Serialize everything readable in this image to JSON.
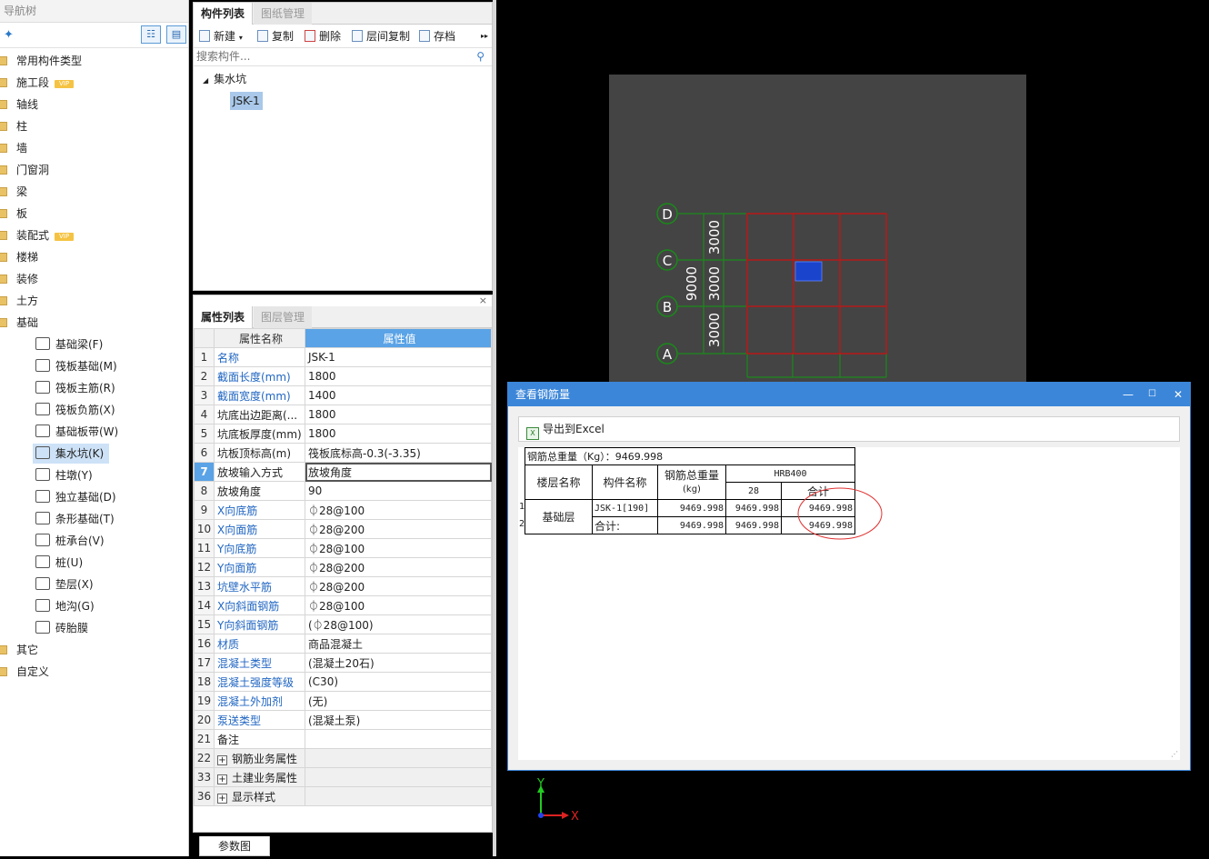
{
  "nav": {
    "title": "导航树",
    "view_toggle_1": "☷",
    "view_toggle_2": "▤",
    "items": [
      {
        "label": "常用构件类型",
        "vip": ""
      },
      {
        "label": "施工段",
        "vip": "VIP"
      },
      {
        "label": "轴线",
        "vip": ""
      },
      {
        "label": "柱",
        "vip": ""
      },
      {
        "label": "墙",
        "vip": ""
      },
      {
        "label": "门窗洞",
        "vip": ""
      },
      {
        "label": "梁",
        "vip": ""
      },
      {
        "label": "板",
        "vip": ""
      },
      {
        "label": "装配式",
        "vip": "VIP"
      },
      {
        "label": "楼梯",
        "vip": ""
      },
      {
        "label": "装修",
        "vip": ""
      },
      {
        "label": "土方",
        "vip": ""
      },
      {
        "label": "基础",
        "vip": ""
      }
    ],
    "children": [
      "基础梁(F)",
      "筏板基础(M)",
      "筏板主筋(R)",
      "筏板负筋(X)",
      "基础板带(W)",
      "集水坑(K)",
      "柱墩(Y)",
      "独立基础(D)",
      "条形基础(T)",
      "桩承台(V)",
      "桩(U)",
      "垫层(X)",
      "地沟(G)",
      "砖胎膜"
    ],
    "selected_child": "集水坑(K)",
    "tail_items": [
      "其它",
      "自定义"
    ]
  },
  "complist": {
    "tab_active": "构件列表",
    "tab_inactive": "图纸管理",
    "toolbar": {
      "new": "新建",
      "copy": "复制",
      "delete": "删除",
      "floor_copy": "层间复制",
      "archive": "存档",
      "more": "▸▸"
    },
    "search_placeholder": "搜索构件...",
    "tree_root": "集水坑",
    "tree_item": "JSK-1"
  },
  "props": {
    "tab_active": "属性列表",
    "tab_inactive": "图层管理",
    "header_name": "属性名称",
    "header_value": "属性值",
    "rows": [
      {
        "num": "1",
        "name": "名称",
        "value": "JSK-1",
        "blue": true
      },
      {
        "num": "2",
        "name": "截面长度(mm)",
        "value": "1800",
        "blue": true
      },
      {
        "num": "3",
        "name": "截面宽度(mm)",
        "value": "1400",
        "blue": true
      },
      {
        "num": "4",
        "name": "坑底出边距离(...",
        "value": "1800",
        "blue": false
      },
      {
        "num": "5",
        "name": "坑底板厚度(mm)",
        "value": "1800",
        "blue": false
      },
      {
        "num": "6",
        "name": "坑板顶标高(m)",
        "value": "筏板底标高-0.3(-3.35)",
        "blue": false
      },
      {
        "num": "7",
        "name": "放坡输入方式",
        "value": "放坡角度",
        "blue": false
      },
      {
        "num": "8",
        "name": "放坡角度",
        "value": "90",
        "blue": false
      },
      {
        "num": "9",
        "name": "X向底筋",
        "value": "⏀28@100",
        "blue": true
      },
      {
        "num": "10",
        "name": "X向面筋",
        "value": "⏀28@200",
        "blue": true
      },
      {
        "num": "11",
        "name": "Y向底筋",
        "value": "⏀28@100",
        "blue": true
      },
      {
        "num": "12",
        "name": "Y向面筋",
        "value": "⏀28@200",
        "blue": true
      },
      {
        "num": "13",
        "name": "坑壁水平筋",
        "value": "⏀28@200",
        "blue": true
      },
      {
        "num": "14",
        "name": "X向斜面钢筋",
        "value": "⏀28@100",
        "blue": true
      },
      {
        "num": "15",
        "name": "Y向斜面钢筋",
        "value": "(⏀28@100)",
        "blue": true
      },
      {
        "num": "16",
        "name": "材质",
        "value": "商品混凝土",
        "blue": true
      },
      {
        "num": "17",
        "name": "混凝土类型",
        "value": "(混凝土20石)",
        "blue": true
      },
      {
        "num": "18",
        "name": "混凝土强度等级",
        "value": "(C30)",
        "blue": true
      },
      {
        "num": "19",
        "name": "混凝土外加剂",
        "value": "(无)",
        "blue": true
      },
      {
        "num": "20",
        "name": "泵送类型",
        "value": "(混凝土泵)",
        "blue": true
      },
      {
        "num": "21",
        "name": "备注",
        "value": "",
        "blue": false
      }
    ],
    "groups": [
      {
        "num": "22",
        "name": "钢筋业务属性"
      },
      {
        "num": "33",
        "name": "土建业务属性"
      },
      {
        "num": "36",
        "name": "显示样式"
      }
    ],
    "selected_row": "7",
    "bottom_tab": "参数图",
    "close": "×"
  },
  "canvas": {
    "axes_rows": [
      "D",
      "C",
      "B",
      "A"
    ],
    "dims_inner": [
      "3000",
      "3000",
      "3000"
    ],
    "dim_total": "9000",
    "axis_x": "X",
    "axis_y": "Y",
    "colors": {
      "bg": "#444444",
      "grid": "#cc1111",
      "green": "#1a8a1a",
      "pit": "#1a44cc"
    }
  },
  "dialog": {
    "title": "查看钢筋量",
    "btn_min": "—",
    "btn_max": "☐",
    "btn_close": "✕",
    "export": "导出到Excel",
    "total_weight": "钢筋总重量（Kg）：9469.998",
    "headers": {
      "floor": "楼层名称",
      "component": "构件名称",
      "total": "钢筋总重量",
      "total_unit": "(kg)",
      "grade": "HRB400",
      "dia": "28",
      "sum": "合计"
    },
    "rows": [
      {
        "idx": "1",
        "component": "JSK-1[190]",
        "total": "9469.998",
        "dia": "9469.998",
        "sum": "9469.998"
      },
      {
        "idx": "2",
        "component": "合计:",
        "total": "9469.998",
        "dia": "9469.998",
        "sum": "9469.998"
      }
    ],
    "floor": "基础层"
  }
}
